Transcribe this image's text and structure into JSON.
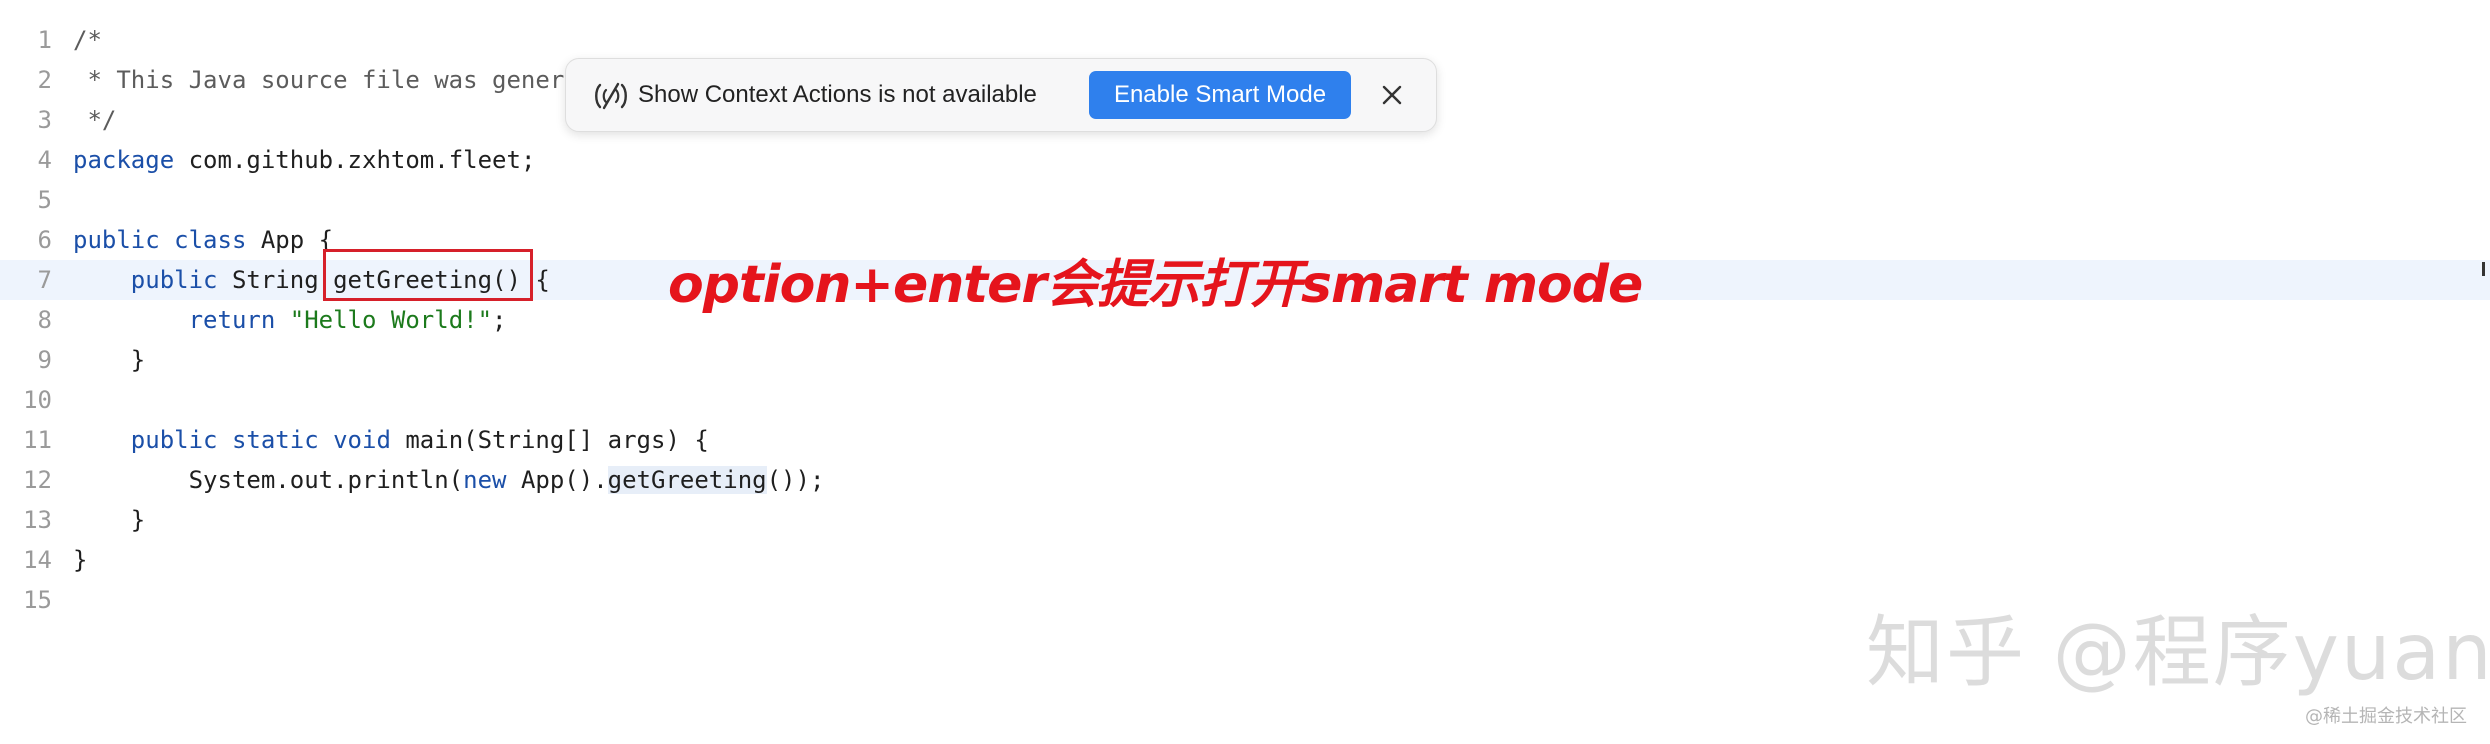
{
  "editor": {
    "current_line": 7,
    "lines": [
      {
        "num": "1",
        "segments": [
          {
            "t": "/*",
            "c": "cmt"
          }
        ]
      },
      {
        "num": "2",
        "segments": [
          {
            "t": " * This Java source file was genera",
            "c": "cmt"
          }
        ]
      },
      {
        "num": "3",
        "segments": [
          {
            "t": " */",
            "c": "cmt"
          }
        ]
      },
      {
        "num": "4",
        "segments": [
          {
            "t": "package",
            "c": "kw"
          },
          {
            "t": " com.github.zxhtom.fleet;",
            "c": ""
          }
        ]
      },
      {
        "num": "5",
        "segments": []
      },
      {
        "num": "6",
        "segments": [
          {
            "t": "public",
            "c": "kw"
          },
          {
            "t": " ",
            "c": ""
          },
          {
            "t": "class",
            "c": "kw"
          },
          {
            "t": " App {",
            "c": ""
          }
        ]
      },
      {
        "num": "7",
        "segments": [
          {
            "t": "    ",
            "c": ""
          },
          {
            "t": "public",
            "c": "kw"
          },
          {
            "t": " String ",
            "c": ""
          },
          {
            "t": "getGreeting() {",
            "c": ""
          }
        ]
      },
      {
        "num": "8",
        "segments": [
          {
            "t": "        ",
            "c": ""
          },
          {
            "t": "return",
            "c": "kw"
          },
          {
            "t": " ",
            "c": ""
          },
          {
            "t": "\"Hello World!\"",
            "c": "str"
          },
          {
            "t": ";",
            "c": ""
          }
        ]
      },
      {
        "num": "9",
        "segments": [
          {
            "t": "    }",
            "c": ""
          }
        ]
      },
      {
        "num": "10",
        "segments": []
      },
      {
        "num": "11",
        "segments": [
          {
            "t": "    ",
            "c": ""
          },
          {
            "t": "public",
            "c": "kw"
          },
          {
            "t": " ",
            "c": ""
          },
          {
            "t": "static",
            "c": "kw"
          },
          {
            "t": " ",
            "c": ""
          },
          {
            "t": "void",
            "c": "kw"
          },
          {
            "t": " main(String[] args) {",
            "c": ""
          }
        ]
      },
      {
        "num": "12",
        "segments": [
          {
            "t": "        System.out.println(",
            "c": ""
          },
          {
            "t": "new",
            "c": "kw"
          },
          {
            "t": " App().",
            "c": ""
          },
          {
            "t": "getGreeting",
            "c": "mref"
          },
          {
            "t": "());",
            "c": ""
          }
        ]
      },
      {
        "num": "13",
        "segments": [
          {
            "t": "    }",
            "c": ""
          }
        ]
      },
      {
        "num": "14",
        "segments": [
          {
            "t": "}",
            "c": ""
          }
        ]
      },
      {
        "num": "15",
        "segments": []
      }
    ]
  },
  "toast": {
    "icon": "no-smart-mode-icon",
    "message": "Show Context Actions is not available",
    "button_label": "Enable Smart Mode",
    "close_icon": "close-icon"
  },
  "annotation": {
    "text": "option+enter会提示打开smart mode",
    "color": "#e5141c"
  },
  "watermark": {
    "main": "知乎 @程序yuan",
    "small": "@稀土掘金技术社区"
  },
  "colors": {
    "keyword": "#1b4fa8",
    "string": "#1c7a1c",
    "accent_button": "#2f80ed",
    "highlight_box": "#d6202a",
    "current_line": "#eef4fd"
  }
}
